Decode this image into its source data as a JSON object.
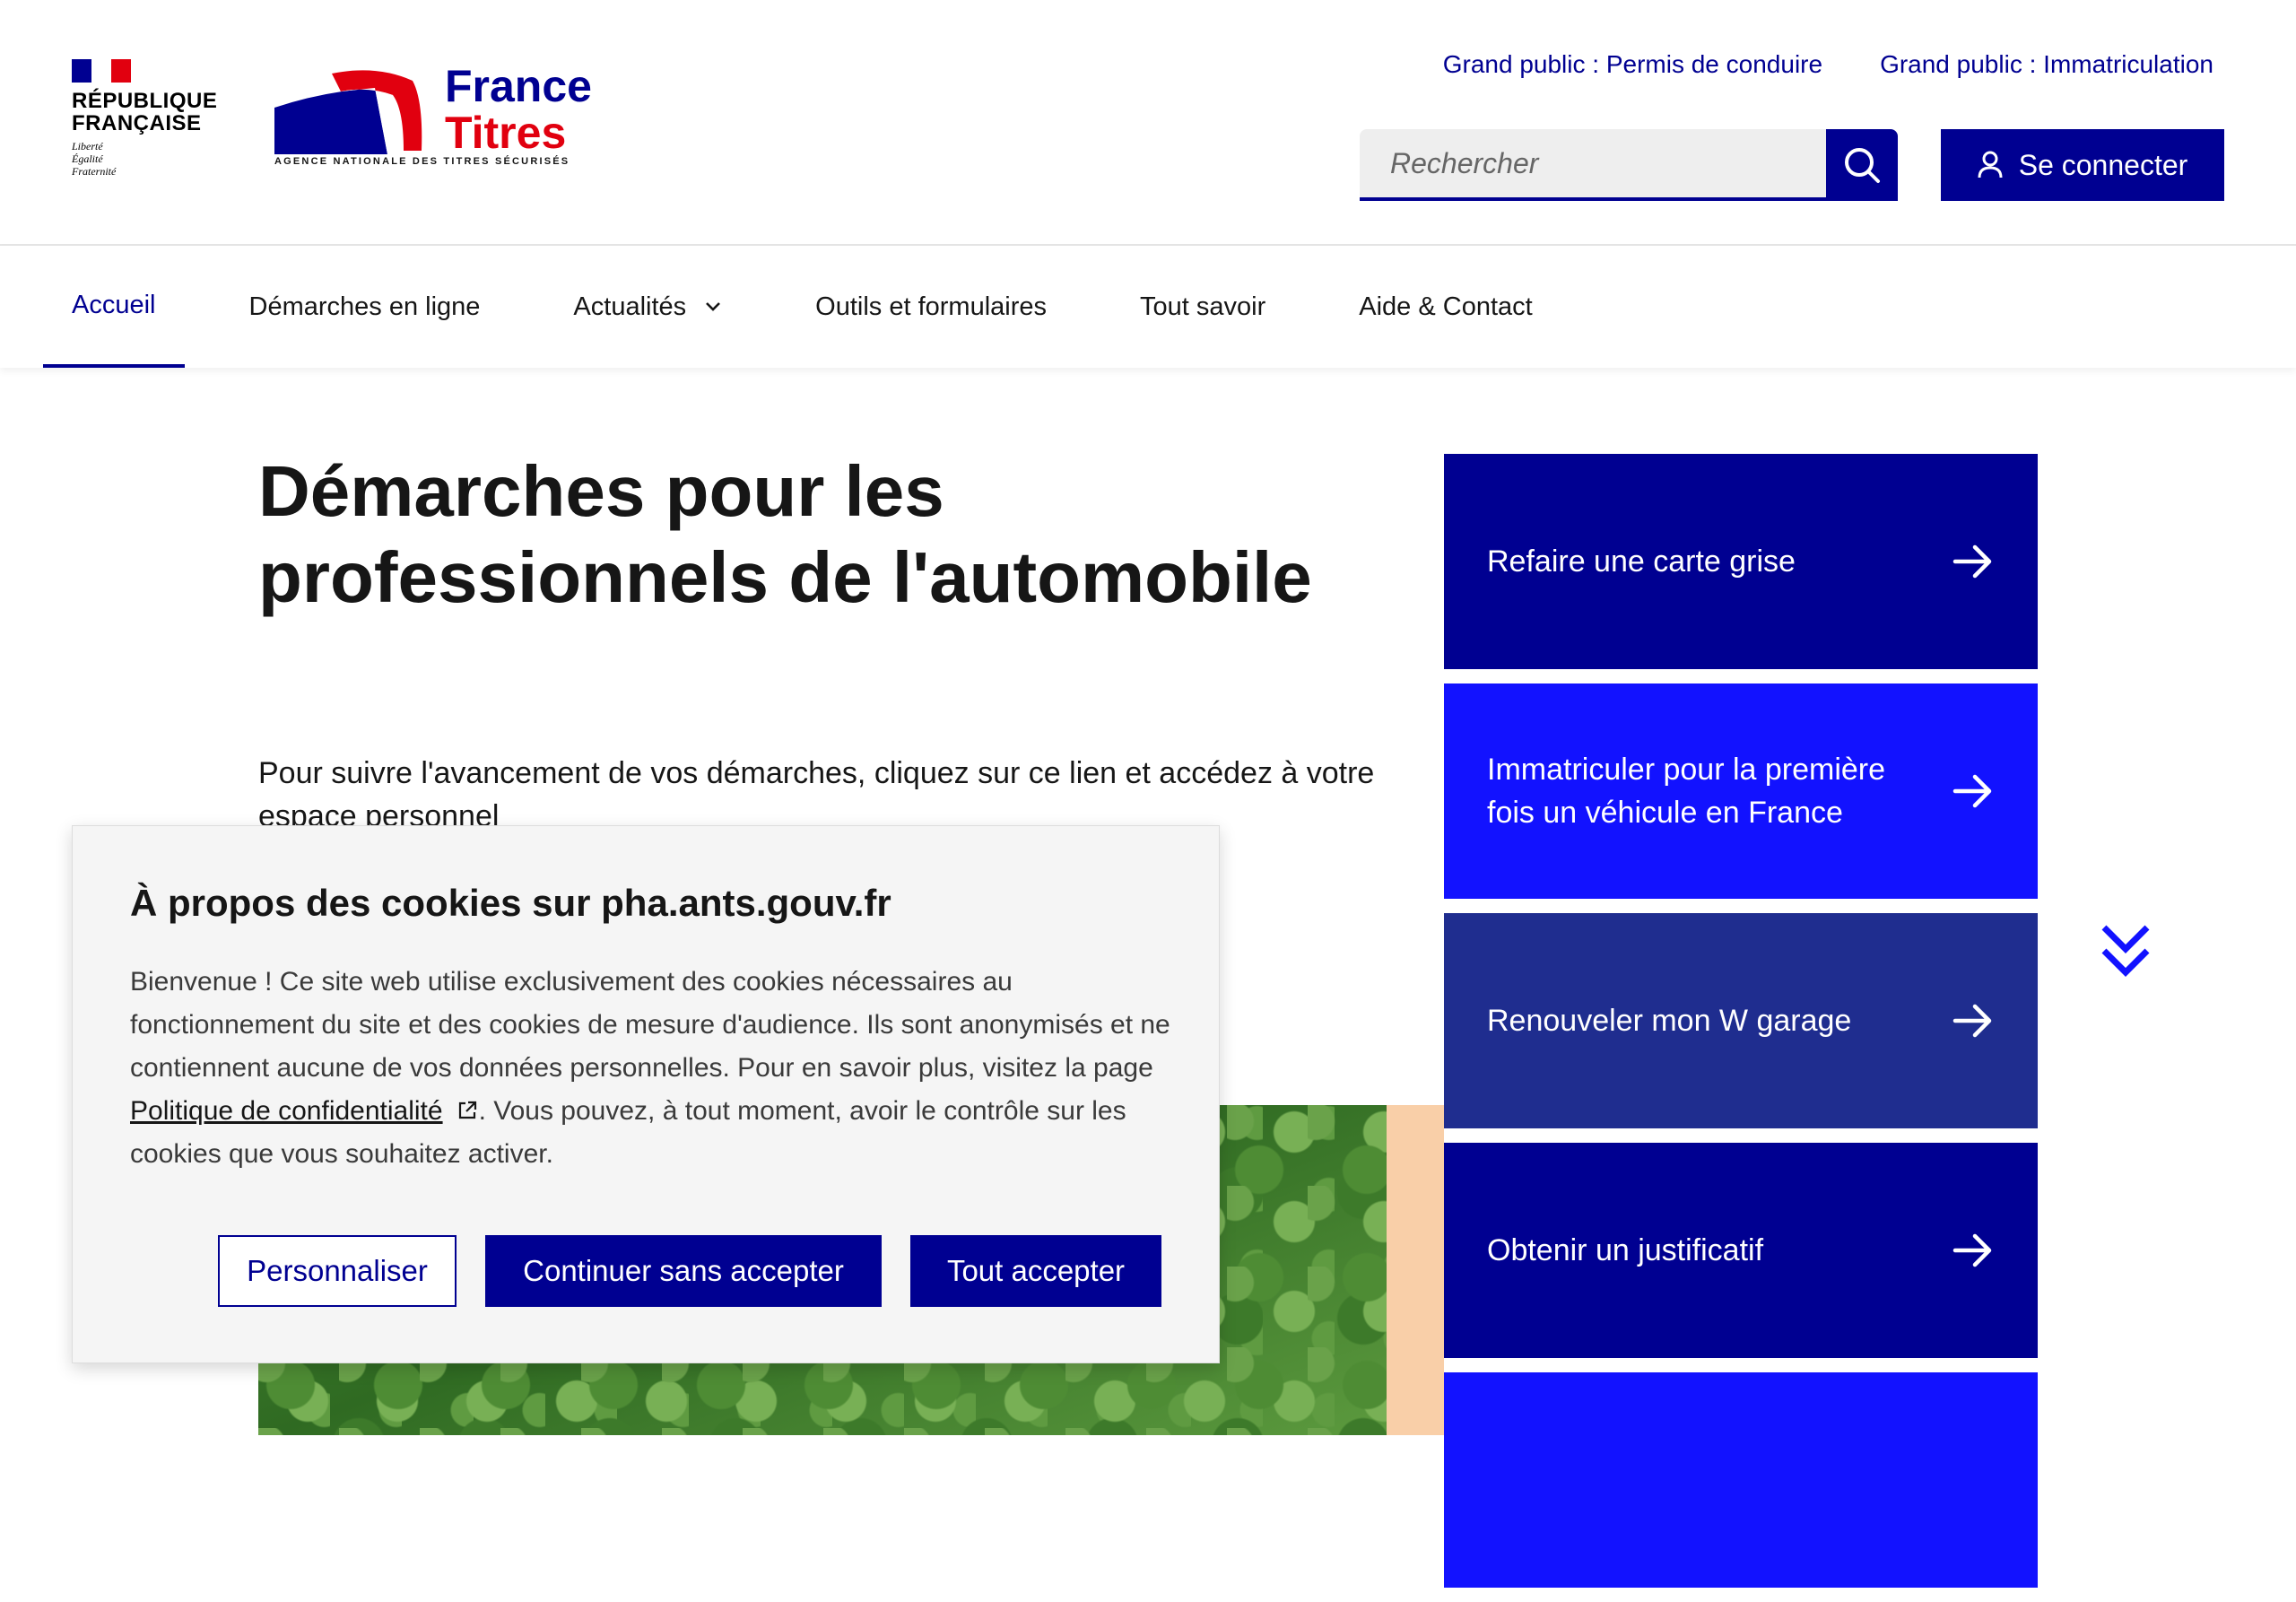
{
  "header": {
    "republique": [
      "RÉPUBLIQUE",
      "FRANÇAISE"
    ],
    "motto": [
      "Liberté",
      "Égalité",
      "Fraternité"
    ],
    "logo_line1": "France",
    "logo_line2": "Titres",
    "logo_sub": "AGENCE NATIONALE DES TITRES SÉCURISÉS",
    "top_links": [
      "Grand public : Permis de conduire",
      "Grand public : Immatriculation"
    ],
    "search_placeholder": "Rechercher",
    "connect_label": "Se connecter",
    "search_icon": "search-icon",
    "user_icon": "user-icon"
  },
  "nav": {
    "items": [
      "Accueil",
      "Démarches en ligne",
      "Actualités",
      "Outils et formulaires",
      "Tout savoir",
      "Aide & Contact"
    ],
    "active": "Accueil"
  },
  "main": {
    "title_line1": "Démarches pour les",
    "title_line2": "professionnels de l'automobile",
    "intro_line1": "Pour suivre l'avancement de vos démarches, cliquez sur ce lien et accédez à votre",
    "intro_line2": "espace personnel"
  },
  "tiles": [
    {
      "label": "Refaire une carte grise",
      "color": "#000091"
    },
    {
      "label": "Immatriculer pour la première fois un véhicule en France",
      "color": "#1212ff"
    },
    {
      "label": "Renouveler mon W garage",
      "color": "#1f2d8f"
    },
    {
      "label": "Obtenir un justificatif",
      "color": "#000091"
    },
    {
      "label": "",
      "color": "#1212ff"
    }
  ],
  "cookie": {
    "title": "À propos des cookies sur pha.ants.gouv.fr",
    "text_before": "Bienvenue ! Ce site web utilise exclusivement des cookies nécessaires au fonctionnement du site et des cookies de mesure d'audience. Ils sont anonymisés et ne contiennent aucune de vos données personnelles. Pour en savoir plus, visitez la page ",
    "link_text": "Politique de confidentialité",
    "text_after": ". Vous pouvez, à tout moment, avoir le contrôle sur les cookies que vous souhaitez activer.",
    "btn_customize": "Personnaliser",
    "btn_continue": "Continuer sans accepter",
    "btn_accept": "Tout accepter"
  },
  "colors": {
    "primary": "#000091",
    "bright_blue": "#1212ff",
    "flag_blue": "#000091",
    "flag_red": "#e1000f",
    "peach": "#f9cfa8"
  }
}
